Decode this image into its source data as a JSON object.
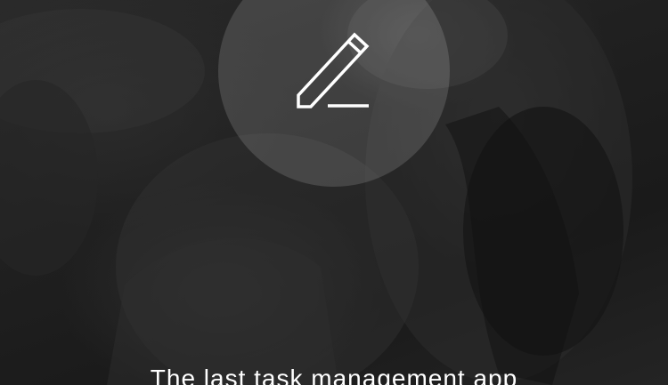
{
  "hero": {
    "icon": "pencil-icon",
    "icon_color": "#ffffff",
    "circle_color": "rgba(255,255,255,0.14)"
  },
  "tagline": "The last task management app",
  "background": {
    "tone": "dark grayscale photo overlay",
    "overlay_color": "#1f1f1f"
  }
}
